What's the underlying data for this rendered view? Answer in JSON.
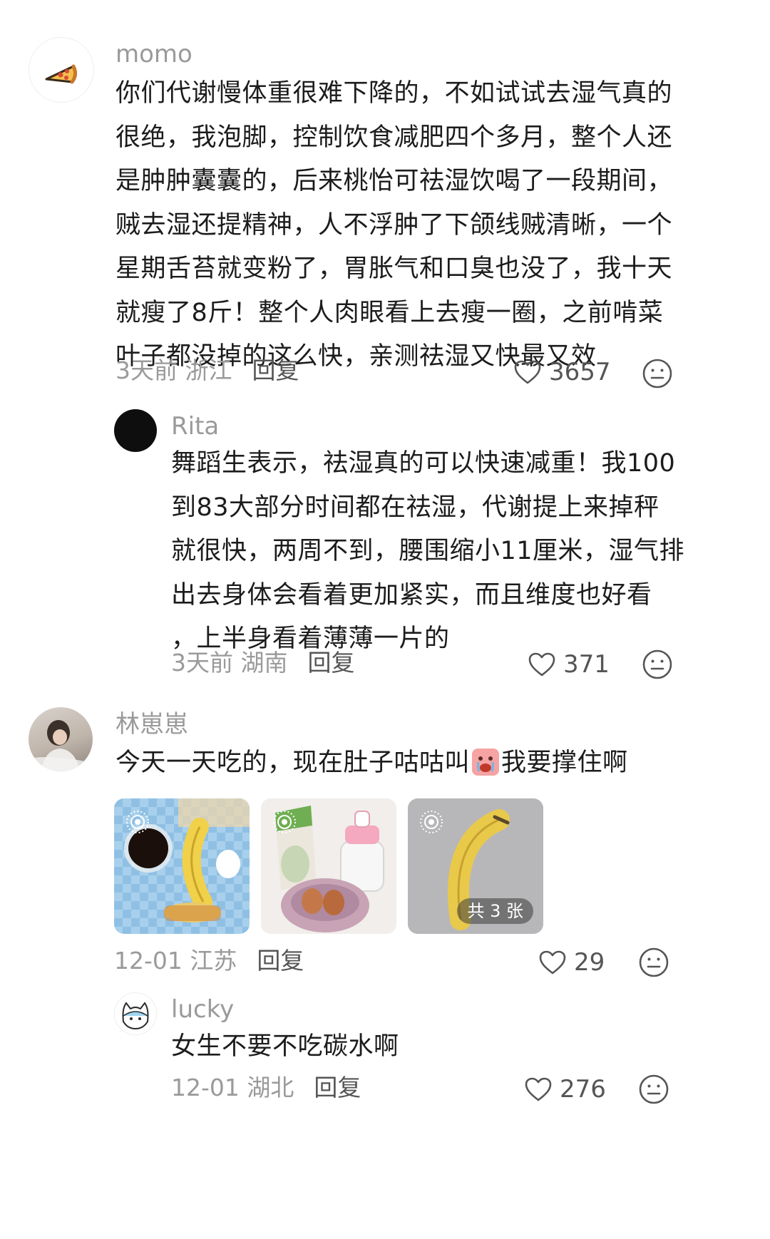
{
  "comments": [
    {
      "username": "momo",
      "text_lines": [
        "你们代谢慢体重很难下降的，不如试试去湿气真的",
        "很绝，我泡脚，控制饮食减肥四个多月，整个人还",
        "是肿肿囊囊的，后来桃怡可祛湿饮喝了一段期间，",
        "贼去湿还提精神，人不浮肿了下颌线贼清晰，一个",
        "星期舌苔就变粉了，胃胀气和口臭也没了，我十天",
        "就瘦了8斤！整个人肉眼看上去瘦一圈，之前啃菜",
        "叶子都没掉的这么快，亲测祛湿又快最又效"
      ],
      "time_location": "3天前 浙江",
      "reply_label": "回复",
      "likes": "3657"
    },
    {
      "username": "Rita",
      "text_lines": [
        "舞蹈生表示，祛湿真的可以快速减重！我100",
        "到83大部分时间都在祛湿，代谢提上来掉秤",
        "就很快，两周不到，腰围缩小11厘米，湿气排",
        "出去身体会看着更加紧实，而且维度也好看",
        "，上半身看着薄薄一片的"
      ],
      "time_location": "3天前 湖南",
      "reply_label": "回复",
      "likes": "371"
    },
    {
      "username": "林崽崽",
      "text_before": "今天一天吃的，现在肚子咕咕叫",
      "text_after": "我要撑住啊",
      "photo_count_label": "共 3 张",
      "time_location": "12-01 江苏",
      "reply_label": "回复",
      "likes": "29"
    },
    {
      "username": "lucky",
      "text": "女生不要不吃碳水啊",
      "time_location": "12-01 湖北",
      "reply_label": "回复",
      "likes": "276"
    }
  ],
  "icons": {
    "like": "heart-outline-icon",
    "dislike": "meh-face-icon",
    "live_photo": "live-photo-icon"
  },
  "colors": {
    "username": "#9a9a9a",
    "body": "#1c1c1c",
    "meta": "#9a9a9a",
    "reply": "#555555"
  }
}
